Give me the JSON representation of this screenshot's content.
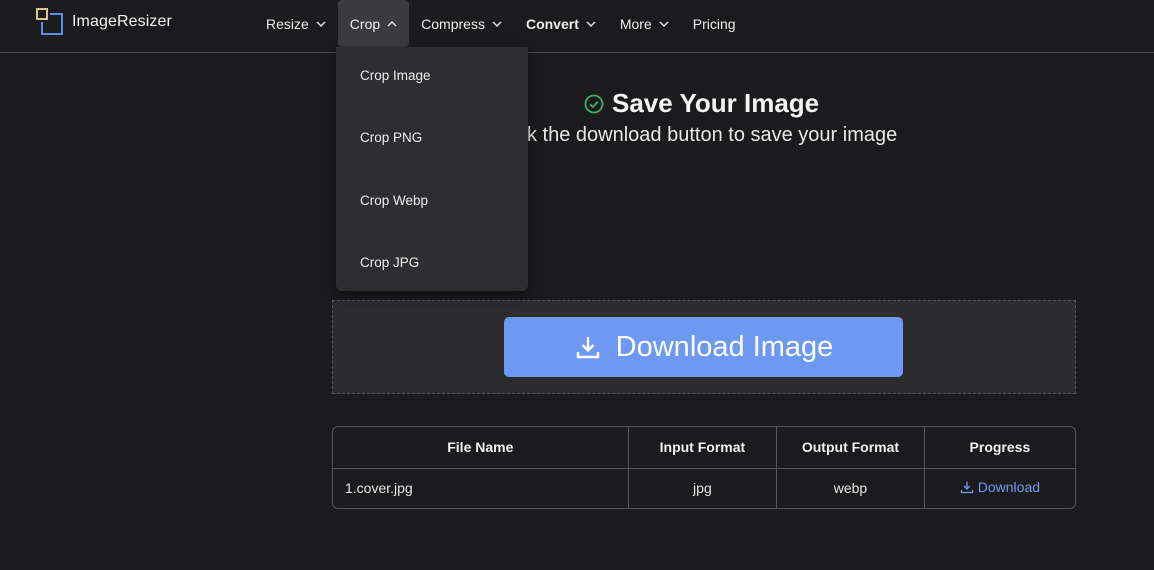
{
  "brand": {
    "name": "ImageResizer"
  },
  "nav": {
    "items": [
      {
        "label": "Resize",
        "has_dropdown": true
      },
      {
        "label": "Crop",
        "has_dropdown": true,
        "open": true
      },
      {
        "label": "Compress",
        "has_dropdown": true
      },
      {
        "label": "Convert",
        "has_dropdown": true
      },
      {
        "label": "More",
        "has_dropdown": true
      },
      {
        "label": "Pricing",
        "has_dropdown": false
      }
    ],
    "crop_menu": [
      "Crop Image",
      "Crop PNG",
      "Crop Webp",
      "Crop JPG"
    ]
  },
  "main": {
    "title": "Save Your Image",
    "subtitle": "k the download button to save your image",
    "download_button": "Download Image"
  },
  "table": {
    "headers": [
      "File Name",
      "Input Format",
      "Output Format",
      "Progress"
    ],
    "rows": [
      {
        "file_name": "1.cover.jpg",
        "input_format": "jpg",
        "output_format": "webp",
        "progress": "Download"
      }
    ]
  },
  "colors": {
    "accent": "#6d99f3",
    "success": "#3fae6a",
    "background": "#1b1b1d"
  }
}
